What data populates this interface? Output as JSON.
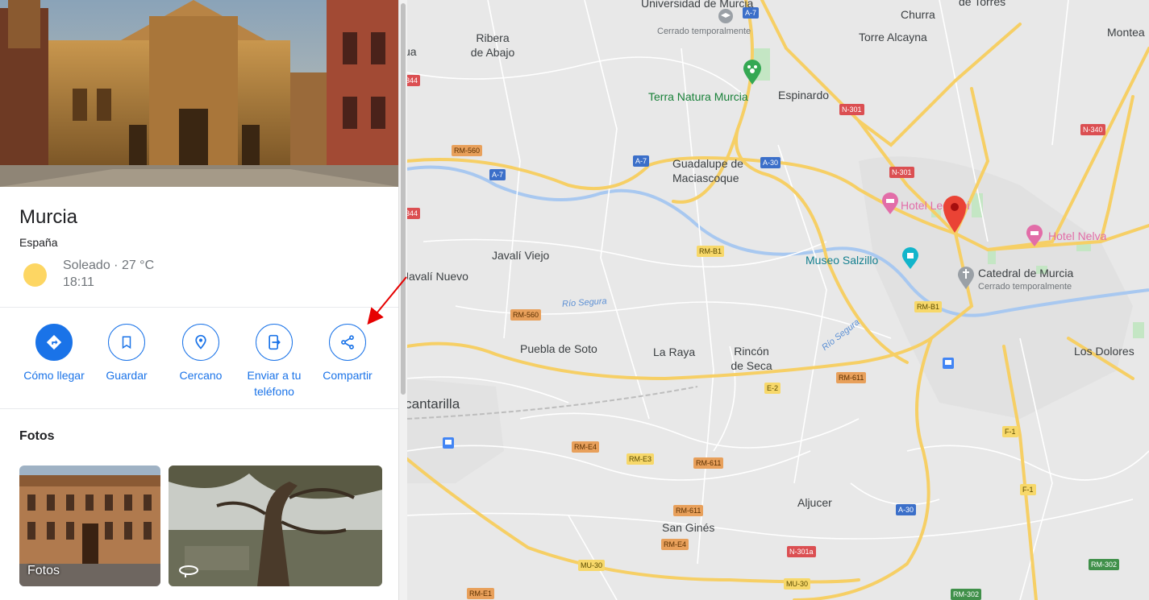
{
  "place": {
    "name": "Murcia",
    "country": "España",
    "weather": "Soleado · 27 °C",
    "time": "18:11"
  },
  "actions": [
    {
      "label": "Cómo llegar",
      "icon": "directions-icon"
    },
    {
      "label": "Guardar",
      "icon": "bookmark-icon"
    },
    {
      "label": "Cercano",
      "icon": "nearby-icon"
    },
    {
      "label": "Enviar a tu teléfono",
      "icon": "send-to-phone-icon"
    },
    {
      "label": "Compartir",
      "icon": "share-icon"
    }
  ],
  "photos": {
    "heading": "Fotos",
    "items": [
      {
        "label": "Fotos"
      },
      {
        "label": ""
      }
    ]
  },
  "map": {
    "places": [
      "Universidad de Murcia",
      "Cerrado temporalmente",
      "Churra",
      "de Torres",
      "Ribera de Abajo",
      "Torre Alcayna",
      "Montea",
      "Terra Natura Murcia",
      "Espinardo",
      "Guadalupe de Maciascoque",
      "Hotel Legazpi",
      "Hotel Nelva",
      "Museo Salzillo",
      "Catedral de Murcia",
      "Cerrado temporalmente",
      "Javalí Viejo",
      "Javalí Nuevo",
      "Río Segura",
      "Río Segura",
      "Puebla de Soto",
      "La Raya",
      "Rincón de Seca",
      "Los Dolores",
      "Alcantarilla",
      "Aljucer",
      "San Ginés",
      "ua"
    ],
    "shields": [
      "A-7",
      "A-7",
      "A-7",
      "A-30",
      "A-30",
      "N-301",
      "N-301",
      "N-340",
      "344",
      "344",
      "RM-560",
      "RM-560",
      "RM-B1",
      "RM-B1",
      "RM-611",
      "RM-611",
      "RM-611",
      "E-2",
      "RM-E4",
      "RM-E3",
      "RM-E4",
      "F-1",
      "F-1",
      "N-301a",
      "MU-30",
      "MU-30",
      "RM-E1",
      "RM-302",
      "RM-302"
    ]
  },
  "colors": {
    "accent": "#1a73e8",
    "pin": "#ea4335",
    "highway": "#f6cf65"
  }
}
